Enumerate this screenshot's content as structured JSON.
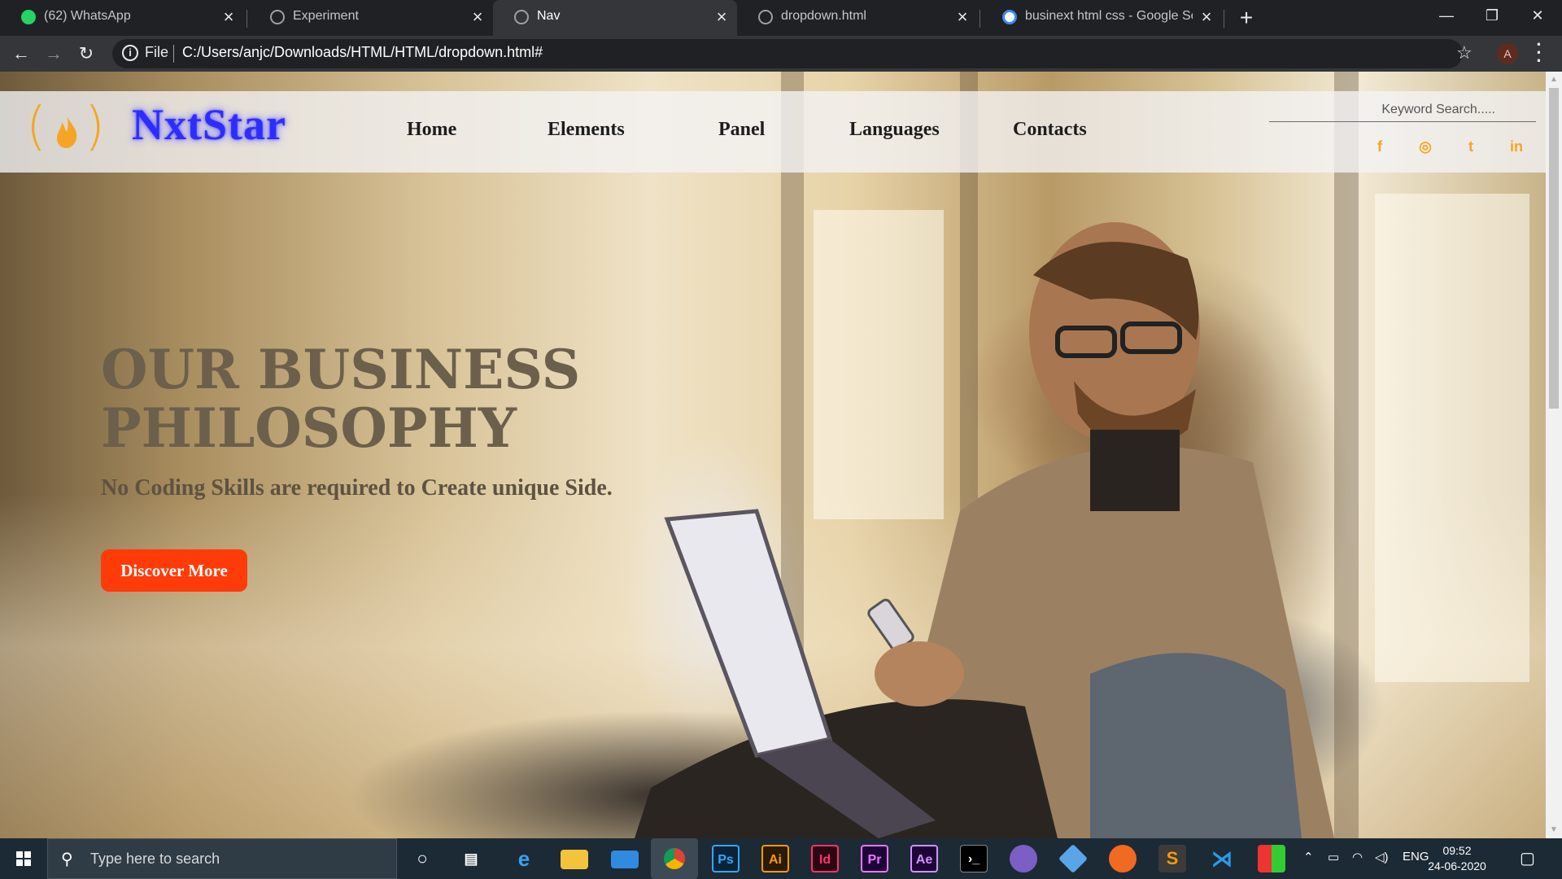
{
  "browser": {
    "tabs": [
      {
        "title": "(62) WhatsApp",
        "badge": "62",
        "active": false
      },
      {
        "title": "Experiment",
        "active": false
      },
      {
        "title": "Nav",
        "active": true
      },
      {
        "title": "dropdown.html",
        "active": false
      },
      {
        "title": "businext html css - Google Searc",
        "active": false
      }
    ],
    "new_tab": "+",
    "address": {
      "scheme_label": "File",
      "url": "C:/Users/anjc/Downloads/HTML/HTML/dropdown.html#"
    },
    "profile_initial": "A"
  },
  "site": {
    "brand": "NxtStar",
    "logo_glyph_left": "(",
    "logo_glyph_right": ")",
    "nav": [
      "Home",
      "Elements",
      "Panel",
      "Languages",
      "Contacts"
    ],
    "search_placeholder": "Keyword  Search.....",
    "social_icons": [
      "facebook-icon",
      "instagram-icon",
      "twitter-icon",
      "linkedin-icon"
    ],
    "social_glyphs": [
      "f",
      "◎",
      "t",
      "in"
    ],
    "brand_color": "#2d2dff",
    "accent_color": "#f5a524",
    "cta_color": "#ff3b0a"
  },
  "hero": {
    "title_line1": "OUR BUSINESS",
    "title_line2": "PHILOSOPHY",
    "subtitle": "No Coding Skills are required to Create unique Side.",
    "cta": "Discover More"
  },
  "taskbar": {
    "search_placeholder": "Type here to search",
    "apps": [
      {
        "name": "chrome-icon",
        "label": ""
      },
      {
        "name": "photoshop-icon",
        "label": "Ps"
      },
      {
        "name": "illustrator-icon",
        "label": "Ai"
      },
      {
        "name": "indesign-icon",
        "label": "Id"
      },
      {
        "name": "premiere-icon",
        "label": "Pr"
      },
      {
        "name": "after-effects-icon",
        "label": "Ae"
      }
    ],
    "language": "ENG",
    "time": "09:52",
    "date": "24-06-2020"
  }
}
